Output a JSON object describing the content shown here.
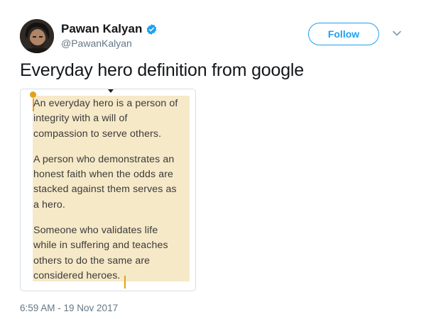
{
  "author": {
    "display_name": "Pawan Kalyan",
    "handle": "@PawanKalyan",
    "verified": true
  },
  "follow_button": {
    "label": "Follow"
  },
  "tweet": {
    "text": "Everyday hero definition from google",
    "timestamp": "6:59 AM - 19 Nov 2017"
  },
  "media": {
    "paragraphs": [
      {
        "lines": [
          "An everyday hero is a person of",
          "integrity with a will of",
          "compassion to serve others."
        ]
      },
      {
        "lines": [
          "A person who demonstrates an",
          "honest faith when the odds are",
          "stacked against them serves as",
          "a hero."
        ]
      },
      {
        "lines": [
          "Someone who validates life",
          "while in suffering and teaches",
          "others to do the same are",
          "considered heroes."
        ]
      }
    ],
    "highlight_color": "#f6e9c8",
    "selection_handle_color": "#e3a11a"
  },
  "colors": {
    "accent": "#1da1f2",
    "text_primary": "#14171a",
    "text_secondary": "#657786"
  },
  "icons": {
    "verified": "verified-badge-icon",
    "more": "chevron-down-icon",
    "avatar": "avatar"
  }
}
